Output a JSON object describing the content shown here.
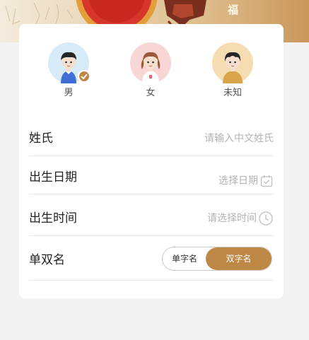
{
  "banner": {
    "char": "福"
  },
  "gender": {
    "options": [
      {
        "label": "男",
        "selected": true
      },
      {
        "label": "女",
        "selected": false
      },
      {
        "label": "未知",
        "selected": false
      }
    ]
  },
  "form": {
    "surname_label": "姓氏",
    "surname_placeholder": "请输入中文姓氏",
    "birth_date_label": "出生日期",
    "birth_date_placeholder": "选择日期",
    "birth_time_label": "出生时间",
    "birth_time_placeholder": "请选择时间",
    "name_type_label": "单双名",
    "name_type_options": [
      "单字名",
      "双字名"
    ],
    "name_type_selected": "双字名"
  },
  "colors": {
    "accent": "#bd8745",
    "male_bg": "#d7eaf7",
    "female_bg": "#f8d6d6",
    "unknown_bg": "#f6dcb3"
  },
  "icons": {
    "date": "calendar-check-icon",
    "time": "clock-icon",
    "selected": "check-icon"
  }
}
